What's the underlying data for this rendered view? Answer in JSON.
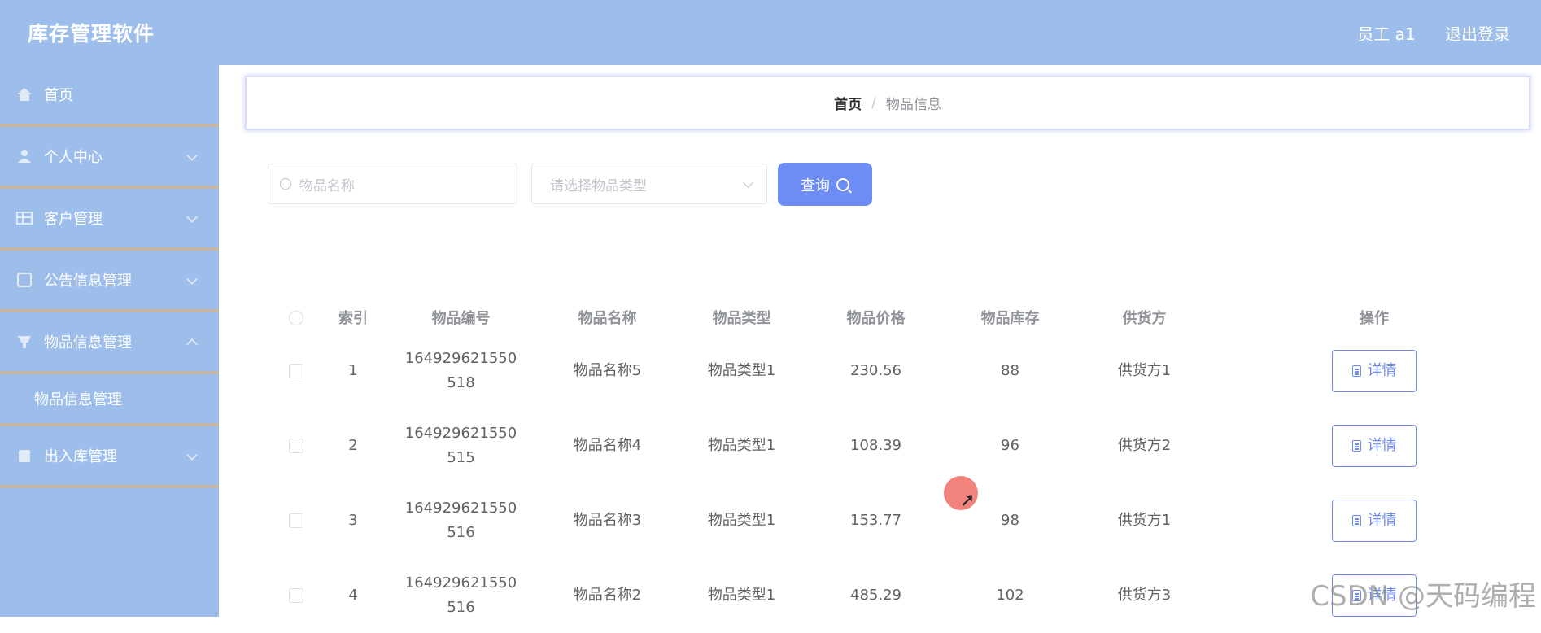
{
  "header": {
    "app_title": "库存管理软件",
    "user_label": "员工 a1",
    "logout_label": "退出登录"
  },
  "sidebar": {
    "items": [
      {
        "label": "首页",
        "icon": "home-icon"
      },
      {
        "label": "个人中心",
        "icon": "user-icon"
      },
      {
        "label": "客户管理",
        "icon": "table-icon"
      },
      {
        "label": "公告信息管理",
        "icon": "notice-icon"
      },
      {
        "label": "物品信息管理",
        "icon": "goods-icon"
      },
      {
        "label": "出入库管理",
        "icon": "warehouse-icon"
      }
    ],
    "sub_item_label": "物品信息管理"
  },
  "breadcrumb": {
    "home": "首页",
    "separator": "/",
    "current": "物品信息"
  },
  "search": {
    "name_placeholder": "物品名称",
    "type_placeholder": "请选择物品类型",
    "query_label": "查询"
  },
  "table": {
    "headers": [
      "索引",
      "物品编号",
      "物品名称",
      "物品类型",
      "物品价格",
      "物品库存",
      "供货方",
      "操作"
    ],
    "rows": [
      {
        "index": "1",
        "code_a": "164929621550",
        "code_b": "518",
        "name": "物品名称5",
        "type": "物品类型1",
        "price": "230.56",
        "stock": "88",
        "supplier": "供货方1"
      },
      {
        "index": "2",
        "code_a": "164929621550",
        "code_b": "515",
        "name": "物品名称4",
        "type": "物品类型1",
        "price": "108.39",
        "stock": "96",
        "supplier": "供货方2"
      },
      {
        "index": "3",
        "code_a": "164929621550",
        "code_b": "516",
        "name": "物品名称3",
        "type": "物品类型1",
        "price": "153.77",
        "stock": "98",
        "supplier": "供货方1"
      },
      {
        "index": "4",
        "code_a": "164929621550",
        "code_b": "516",
        "name": "物品名称2",
        "type": "物品类型1",
        "price": "485.29",
        "stock": "102",
        "supplier": "供货方3"
      }
    ],
    "detail_label": "详情"
  },
  "watermark": "CSDN @天码编程",
  "colors": {
    "sidebar_bg": "#9dbeea",
    "accent": "#6d8df5"
  }
}
